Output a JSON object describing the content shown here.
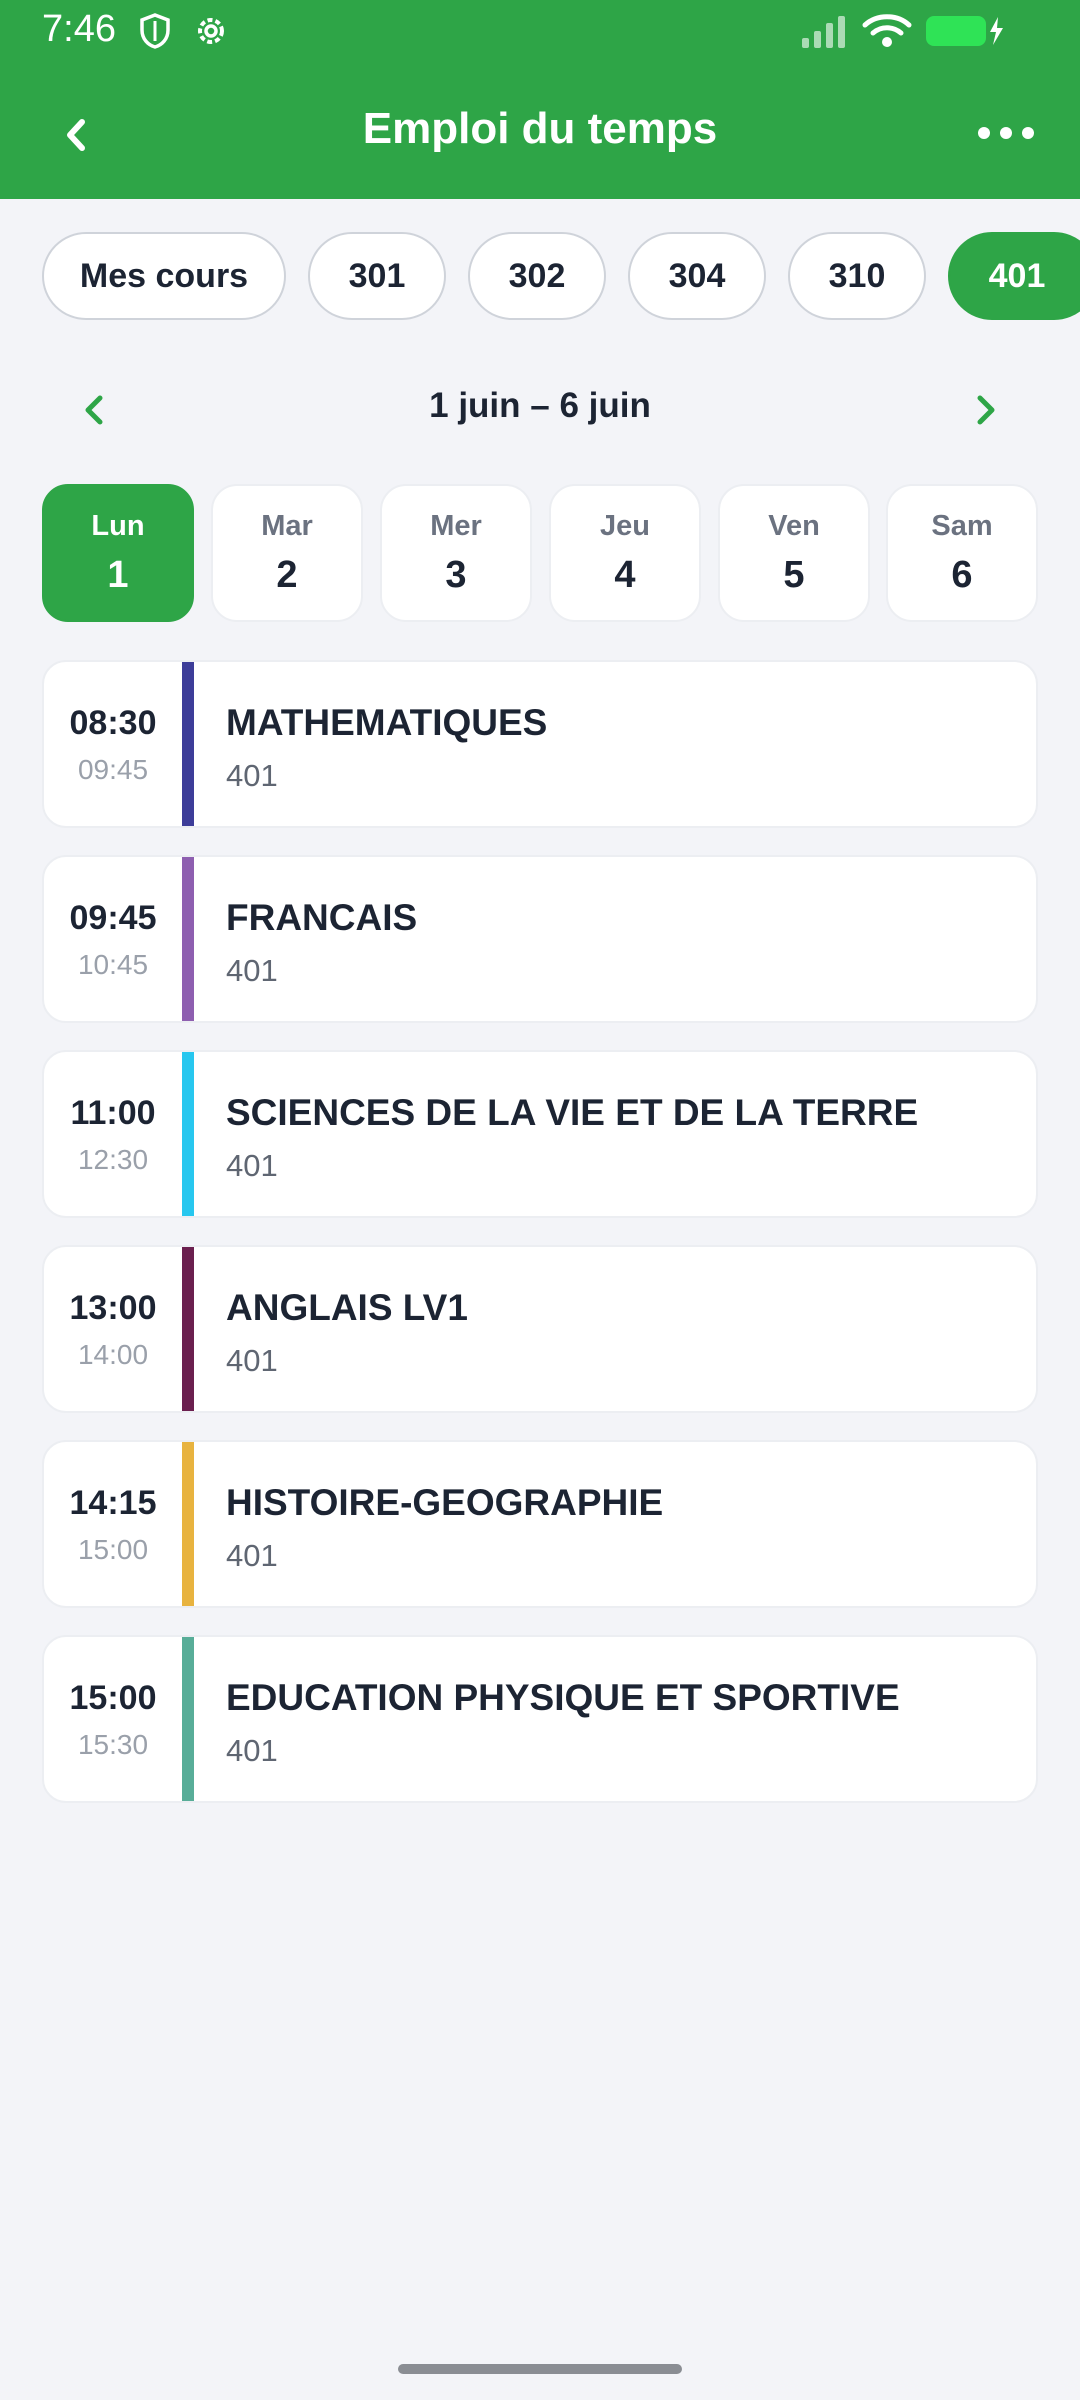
{
  "status_bar": {
    "time": "7:46"
  },
  "header": {
    "title": "Emploi du temps",
    "back_icon": "chevron-left-icon",
    "more_icon": "more-horizontal-icon",
    "background": "#2ea547"
  },
  "class_tabs": [
    {
      "label": "Mes cours",
      "active": false
    },
    {
      "label": "301",
      "active": false
    },
    {
      "label": "302",
      "active": false
    },
    {
      "label": "304",
      "active": false
    },
    {
      "label": "310",
      "active": false
    },
    {
      "label": "401",
      "active": true
    }
  ],
  "week": {
    "range": "1 juin – 6 juin",
    "prev_icon": "chevron-left-icon",
    "next_icon": "chevron-right-icon"
  },
  "days": [
    {
      "name": "Lun",
      "number": "1",
      "active": true
    },
    {
      "name": "Mar",
      "number": "2",
      "active": false
    },
    {
      "name": "Mer",
      "number": "3",
      "active": false
    },
    {
      "name": "Jeu",
      "number": "4",
      "active": false
    },
    {
      "name": "Ven",
      "number": "5",
      "active": false
    },
    {
      "name": "Sam",
      "number": "6",
      "active": false
    }
  ],
  "lessons": [
    {
      "start": "08:30",
      "end": "09:45",
      "subject": "MATHEMATIQUES",
      "room": "401",
      "color": "#3d3d99"
    },
    {
      "start": "09:45",
      "end": "10:45",
      "subject": "FRANCAIS",
      "room": "401",
      "color": "#8e5fb0"
    },
    {
      "start": "11:00",
      "end": "12:30",
      "subject": "SCIENCES DE LA VIE ET DE LA TERRE",
      "room": "401",
      "color": "#27c7ef"
    },
    {
      "start": "13:00",
      "end": "14:00",
      "subject": "ANGLAIS LV1",
      "room": "401",
      "color": "#6b1f4f"
    },
    {
      "start": "14:15",
      "end": "15:00",
      "subject": "HISTOIRE-GEOGRAPHIE",
      "room": "401",
      "color": "#e8b33f"
    },
    {
      "start": "15:00",
      "end": "15:30",
      "subject": "EDUCATION PHYSIQUE ET SPORTIVE",
      "room": "401",
      "color": "#58ad98"
    }
  ]
}
